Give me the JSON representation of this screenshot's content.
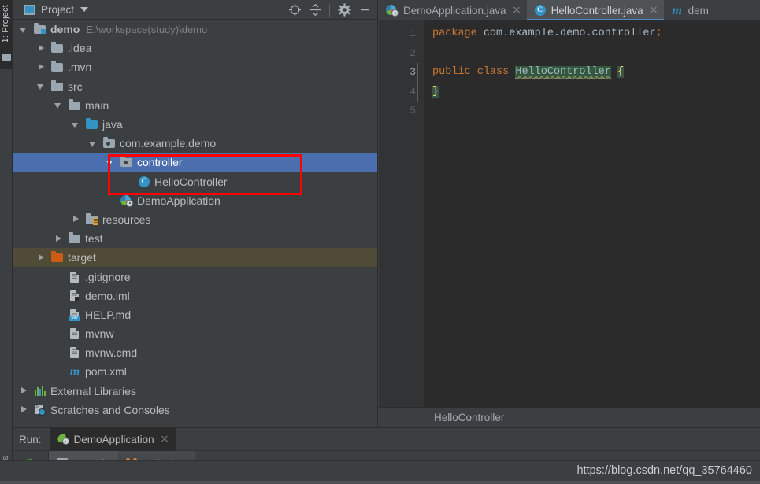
{
  "window": {
    "left_strip_top_label": "1: Project",
    "left_strip_bottom_label": "vorites"
  },
  "project_panel": {
    "title": "Project",
    "tools": [
      {
        "name": "locate-icon",
        "label": "Select Opened File"
      },
      {
        "name": "collapse-all-icon",
        "label": "Collapse All"
      },
      {
        "name": "gear-icon",
        "label": "Settings"
      },
      {
        "name": "minimize-icon",
        "label": "Hide"
      }
    ],
    "tree": [
      {
        "label": "demo",
        "path": "E:\\workspace(study)\\demo",
        "icon": "module-folder-icon",
        "indent": 0,
        "arrow": "down",
        "bold": true,
        "state": "normal"
      },
      {
        "label": ".idea",
        "path": "",
        "icon": "folder-icon",
        "indent": 1,
        "arrow": "right",
        "bold": false,
        "state": "normal"
      },
      {
        "label": ".mvn",
        "path": "",
        "icon": "folder-icon",
        "indent": 1,
        "arrow": "right",
        "bold": false,
        "state": "normal"
      },
      {
        "label": "src",
        "path": "",
        "icon": "folder-icon",
        "indent": 1,
        "arrow": "down",
        "bold": false,
        "state": "normal"
      },
      {
        "label": "main",
        "path": "",
        "icon": "folder-icon",
        "indent": 2,
        "arrow": "down",
        "bold": false,
        "state": "normal"
      },
      {
        "label": "java",
        "path": "",
        "icon": "source-root-folder-icon",
        "indent": 3,
        "arrow": "down",
        "bold": false,
        "state": "normal"
      },
      {
        "label": "com.example.demo",
        "path": "",
        "icon": "package-folder-icon",
        "indent": 4,
        "arrow": "down",
        "bold": false,
        "state": "normal"
      },
      {
        "label": "controller",
        "path": "",
        "icon": "package-folder-icon",
        "indent": 5,
        "arrow": "down",
        "bold": false,
        "state": "selected"
      },
      {
        "label": "HelloController",
        "path": "",
        "icon": "java-class-icon",
        "indent": 6,
        "arrow": "none",
        "bold": false,
        "state": "normal"
      },
      {
        "label": "DemoApplication",
        "path": "",
        "icon": "spring-boot-app-icon",
        "indent": 5,
        "arrow": "none",
        "bold": false,
        "state": "normal"
      },
      {
        "label": "resources",
        "path": "",
        "icon": "resource-root-folder-icon",
        "indent": 3,
        "arrow": "right",
        "bold": false,
        "state": "normal"
      },
      {
        "label": "test",
        "path": "",
        "icon": "folder-icon",
        "indent": 2,
        "arrow": "right",
        "bold": false,
        "state": "normal"
      },
      {
        "label": "target",
        "path": "",
        "icon": "excluded-folder-icon",
        "indent": 1,
        "arrow": "right",
        "bold": false,
        "state": "marked"
      },
      {
        "label": ".gitignore",
        "path": "",
        "icon": "file-icon",
        "indent": 2,
        "arrow": "none",
        "bold": false,
        "state": "normal"
      },
      {
        "label": "demo.iml",
        "path": "",
        "icon": "iml-file-icon",
        "indent": 2,
        "arrow": "none",
        "bold": false,
        "state": "normal"
      },
      {
        "label": "HELP.md",
        "path": "",
        "icon": "markdown-file-icon",
        "indent": 2,
        "arrow": "none",
        "bold": false,
        "state": "normal"
      },
      {
        "label": "mvnw",
        "path": "",
        "icon": "file-icon",
        "indent": 2,
        "arrow": "none",
        "bold": false,
        "state": "normal"
      },
      {
        "label": "mvnw.cmd",
        "path": "",
        "icon": "file-icon",
        "indent": 2,
        "arrow": "none",
        "bold": false,
        "state": "normal"
      },
      {
        "label": "pom.xml",
        "path": "",
        "icon": "maven-file-icon",
        "indent": 2,
        "arrow": "none",
        "bold": false,
        "state": "normal"
      },
      {
        "label": "External Libraries",
        "path": "",
        "icon": "libraries-icon",
        "indent": 0,
        "arrow": "right",
        "bold": false,
        "state": "normal"
      },
      {
        "label": "Scratches and Consoles",
        "path": "",
        "icon": "scratches-icon",
        "indent": 0,
        "arrow": "right",
        "bold": false,
        "state": "normal"
      }
    ],
    "annotation": {
      "name": "red-highlight-box",
      "color": "#fe0000"
    }
  },
  "editor": {
    "tabs": [
      {
        "label": "DemoApplication.java",
        "icon": "spring-boot-app-icon",
        "active": false,
        "closable": true
      },
      {
        "label": "HelloController.java",
        "icon": "java-class-icon",
        "active": true,
        "closable": true
      },
      {
        "label": "dem",
        "icon": "maven-file-icon",
        "active": false,
        "closable": false
      }
    ],
    "gutter_lines": [
      "1",
      "2",
      "3",
      "4",
      "5"
    ],
    "current_line": "3",
    "code_lines": [
      {
        "n": 1,
        "tokens": [
          {
            "text": "package",
            "style": "kw"
          },
          {
            "text": " com.example.demo.controller",
            "style": "plain"
          },
          {
            "text": ";",
            "style": "semi"
          }
        ]
      },
      {
        "n": 2,
        "tokens": []
      },
      {
        "n": 3,
        "tokens": [
          {
            "text": "public",
            "style": "kw"
          },
          {
            "text": " ",
            "style": "plain"
          },
          {
            "text": "class",
            "style": "kw"
          },
          {
            "text": " ",
            "style": "plain"
          },
          {
            "text": "HelloController",
            "style": "cname"
          },
          {
            "text": " ",
            "style": "plain"
          },
          {
            "text": "{",
            "style": "brace"
          }
        ]
      },
      {
        "n": 4,
        "tokens": [
          {
            "text": "}",
            "style": "brace"
          }
        ]
      },
      {
        "n": 5,
        "tokens": []
      }
    ],
    "breadcrumb": "HelloController"
  },
  "run_panel": {
    "label": "Run:",
    "configuration": "DemoApplication",
    "config_icon": "spring-boot-app-icon",
    "close_icon": "close-icon",
    "rerun_icon": "rerun-icon",
    "subtabs": [
      {
        "label": "Console",
        "icon": "console-icon",
        "active": true
      },
      {
        "label": "Endpoints",
        "icon": "endpoints-icon",
        "active": false
      }
    ]
  },
  "status_bar": {
    "watermark": "https://blog.csdn.net/qq_35764460"
  },
  "colors": {
    "selection_blue": "#4b6eaf",
    "marked_olive": "#4f4b36",
    "panel_bg": "#3c3f41",
    "editor_bg": "#2b2b2b",
    "gutter_bg": "#313335",
    "accent_blue": "#3592c4",
    "spring_green": "#6db33f",
    "excluded_orange": "#cc5c14",
    "keyword_orange": "#cc7832",
    "annotation_red": "#fe0000"
  }
}
